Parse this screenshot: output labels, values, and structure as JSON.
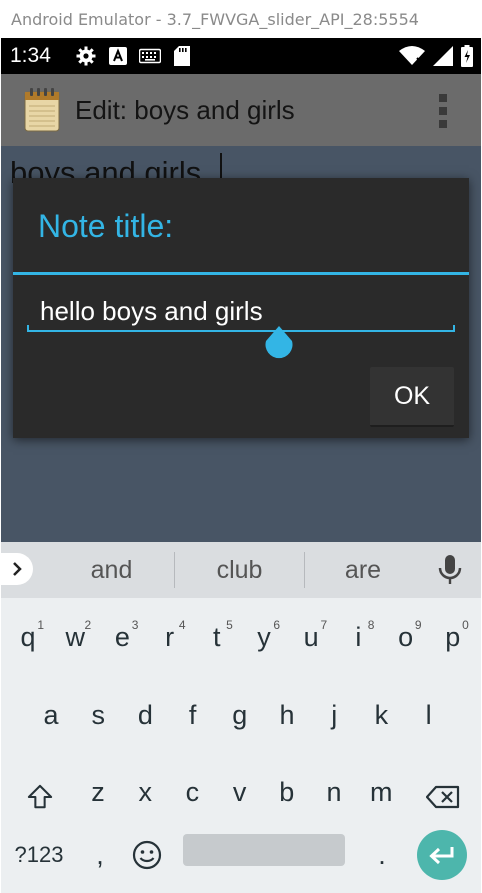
{
  "window": {
    "title": "Android Emulator - 3.7_FWVGA_slider_API_28:5554"
  },
  "status_bar": {
    "time": "1:34"
  },
  "action_bar": {
    "title": "Edit: boys and girls"
  },
  "editor": {
    "text": "boys and girls"
  },
  "dialog": {
    "title": "Note title:",
    "input_value": "hello boys and girls",
    "ok_label": "OK",
    "accent_color": "#33b5e5"
  },
  "keyboard": {
    "suggestions": [
      "and",
      "club",
      "are"
    ],
    "row1": [
      {
        "key": "q",
        "hint": "1"
      },
      {
        "key": "w",
        "hint": "2"
      },
      {
        "key": "e",
        "hint": "3"
      },
      {
        "key": "r",
        "hint": "4"
      },
      {
        "key": "t",
        "hint": "5"
      },
      {
        "key": "y",
        "hint": "6"
      },
      {
        "key": "u",
        "hint": "7"
      },
      {
        "key": "i",
        "hint": "8"
      },
      {
        "key": "o",
        "hint": "9"
      },
      {
        "key": "p",
        "hint": "0"
      }
    ],
    "row2": [
      "a",
      "s",
      "d",
      "f",
      "g",
      "h",
      "j",
      "k",
      "l"
    ],
    "row3": [
      "z",
      "x",
      "c",
      "v",
      "b",
      "n",
      "m"
    ],
    "symbols_label": "?123",
    "comma": ",",
    "period": ".",
    "enter_color": "#4db6ac"
  }
}
